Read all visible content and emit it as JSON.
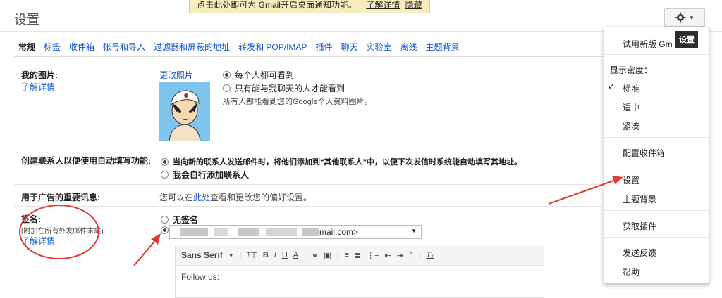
{
  "page": {
    "title": "设置"
  },
  "notify_bar": {
    "text": "点击此处即可为 Gmail开启桌面通知功能。",
    "learn_more": "了解详情",
    "hide": "隐藏"
  },
  "tabs": [
    {
      "label": "常规",
      "active": true
    },
    {
      "label": "标签"
    },
    {
      "label": "收件箱"
    },
    {
      "label": "帐号和导入"
    },
    {
      "label": "过滤器和屏蔽的地址"
    },
    {
      "label": "转发和 POP/IMAP"
    },
    {
      "label": "插件"
    },
    {
      "label": "聊天"
    },
    {
      "label": "实验室"
    },
    {
      "label": "离线"
    },
    {
      "label": "主题背景"
    }
  ],
  "my_picture": {
    "label": "我的图片:",
    "learn_more": "了解详情",
    "change_photo": "更改照片",
    "opt_everyone": "每个人都可看到",
    "opt_chat_only": "只有能与我聊天的人才能看到",
    "note": "所有人都能看到您的Google个人资料图片。"
  },
  "autocomplete": {
    "label": "创建联系人以便使用自动填写功能:",
    "opt_auto": "当向新的联系人发送邮件时，将他们添加到“其他联系人”中，以便下次发信时系统能自动填写其地址。",
    "opt_manual": "我会自行添加联系人"
  },
  "ads": {
    "label": "用于广告的重要讯息:",
    "text_before": "您可以在",
    "link": "此处",
    "text_after": "查看和更改您的偏好设置。"
  },
  "signature": {
    "label": "签名:",
    "sub": "(附加在所有外发邮件末尾)",
    "learn_more": "了解详情",
    "opt_none": "无签名",
    "email_tail": "mail.com>",
    "font": "Sans Serif",
    "body": "Follow us:"
  },
  "gear": {
    "tooltip": "设置"
  },
  "menu": {
    "try_new": "试用新版 Gm",
    "density_header": "显示密度：",
    "density_standard": "标准",
    "density_comfortable": "适中",
    "density_compact": "紧凑",
    "configure_inbox": "配置收件箱",
    "settings": "设置",
    "themes": "主题背景",
    "get_addons": "获取插件",
    "feedback": "发送反馈",
    "help": "帮助"
  },
  "colors": {
    "link": "#1155cc",
    "annotation": "#e53935",
    "tooltip_bg": "#2d2d2d",
    "notify_bg": "#f9edbe"
  },
  "icons": [
    "gear-icon",
    "chevron-down-icon",
    "checkmark-icon",
    "avatar-image",
    "link-icon",
    "image-icon",
    "quote-icon",
    "clear-format-icon"
  ]
}
